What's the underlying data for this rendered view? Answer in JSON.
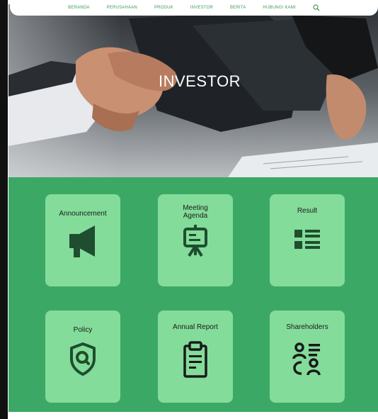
{
  "nav": {
    "items": [
      "BERANDA",
      "PERUSAHAAN",
      "PRODUK",
      "INVESTOR",
      "BERITA",
      "HUBUNGI KAMI"
    ],
    "search_icon": "search-icon"
  },
  "hero": {
    "title": "INVESTOR"
  },
  "cards": [
    {
      "label": "Announcement",
      "icon": "megaphone-icon"
    },
    {
      "label": "Meeting\nAgenda",
      "icon": "presentation-board-icon"
    },
    {
      "label": "Result",
      "icon": "list-icon"
    },
    {
      "label": "Policy",
      "icon": "shield-search-icon"
    },
    {
      "label": "Annual Report",
      "icon": "clipboard-icon"
    },
    {
      "label": "Shareholders",
      "icon": "users-list-icon"
    }
  ],
  "colors": {
    "accent_green": "#3ca866",
    "card_green": "#83dc99",
    "icon_dark": "#1f4d2f",
    "nav_text": "#3e9b57"
  }
}
